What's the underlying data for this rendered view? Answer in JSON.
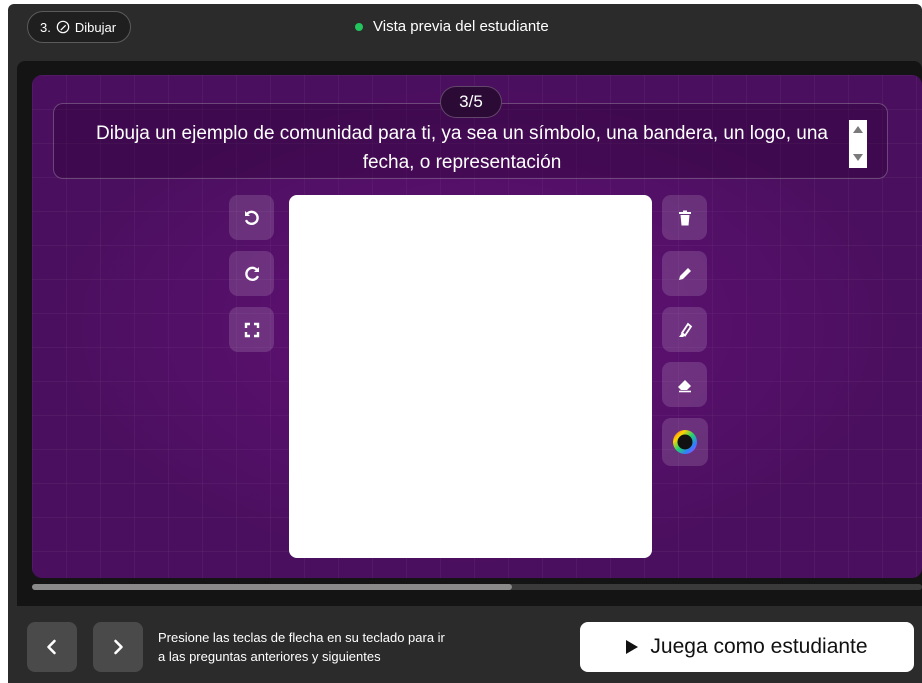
{
  "header": {
    "step_label": "3.",
    "mode_label": "Dibujar",
    "preview_label": "Vista previa del estudiante"
  },
  "question": {
    "counter": "3/5",
    "text": "Dibuja un ejemplo de comunidad para ti, ya sea un símbolo, una bandera, un logo, una fecha, o representación"
  },
  "tools": {
    "left": [
      "undo-icon",
      "redo-icon",
      "fullscreen-icon"
    ],
    "right": [
      "trash-icon",
      "pencil-icon",
      "highlighter-icon",
      "eraser-icon",
      "color-wheel-icon"
    ]
  },
  "footer": {
    "hint_line1": "Presione las teclas de flecha en su teclado para ir",
    "hint_line2": "a las preguntas anteriores y siguientes",
    "play_label": "Juega como estudiante"
  },
  "colors": {
    "accent_green": "#22c55e",
    "board_purple": "#4a0f5e"
  }
}
